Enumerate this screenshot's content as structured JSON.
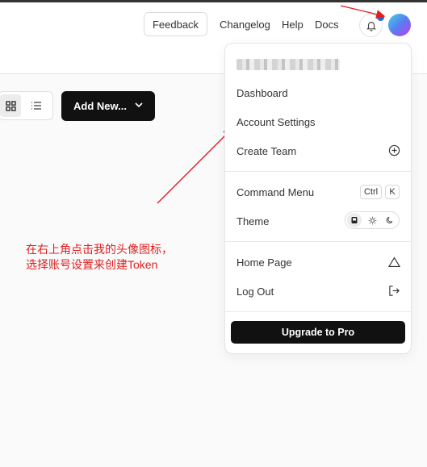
{
  "header": {
    "feedback_label": "Feedback",
    "nav": [
      {
        "label": "Changelog"
      },
      {
        "label": "Help"
      },
      {
        "label": "Docs"
      }
    ],
    "notification_icon": "bell-icon",
    "avatar_gradient": [
      "#3fd3e8",
      "#5a7cf0",
      "#c23ef2"
    ]
  },
  "toolbar": {
    "grid_icon": "grid-view-icon",
    "list_icon": "list-view-icon",
    "add_new_label": "Add New...",
    "add_new_chevron": "chevron-down-icon"
  },
  "annotation": {
    "line1": "在右上角点击我的头像图标，",
    "line2": "选择账号设置来创建Token",
    "color": "#e02020"
  },
  "menu": {
    "items": [
      {
        "label": "Dashboard"
      },
      {
        "label": "Account Settings"
      },
      {
        "label": "Create Team",
        "icon": "plus-circle-icon"
      },
      {
        "label": "Command Menu",
        "shortcut": [
          "Ctrl",
          "K"
        ]
      },
      {
        "label": "Theme",
        "options": [
          "device-icon",
          "sun-icon",
          "moon-icon"
        ]
      },
      {
        "label": "Home Page",
        "icon": "triangle-icon"
      },
      {
        "label": "Log Out",
        "icon": "logout-icon"
      }
    ],
    "upgrade_label": "Upgrade to Pro"
  }
}
